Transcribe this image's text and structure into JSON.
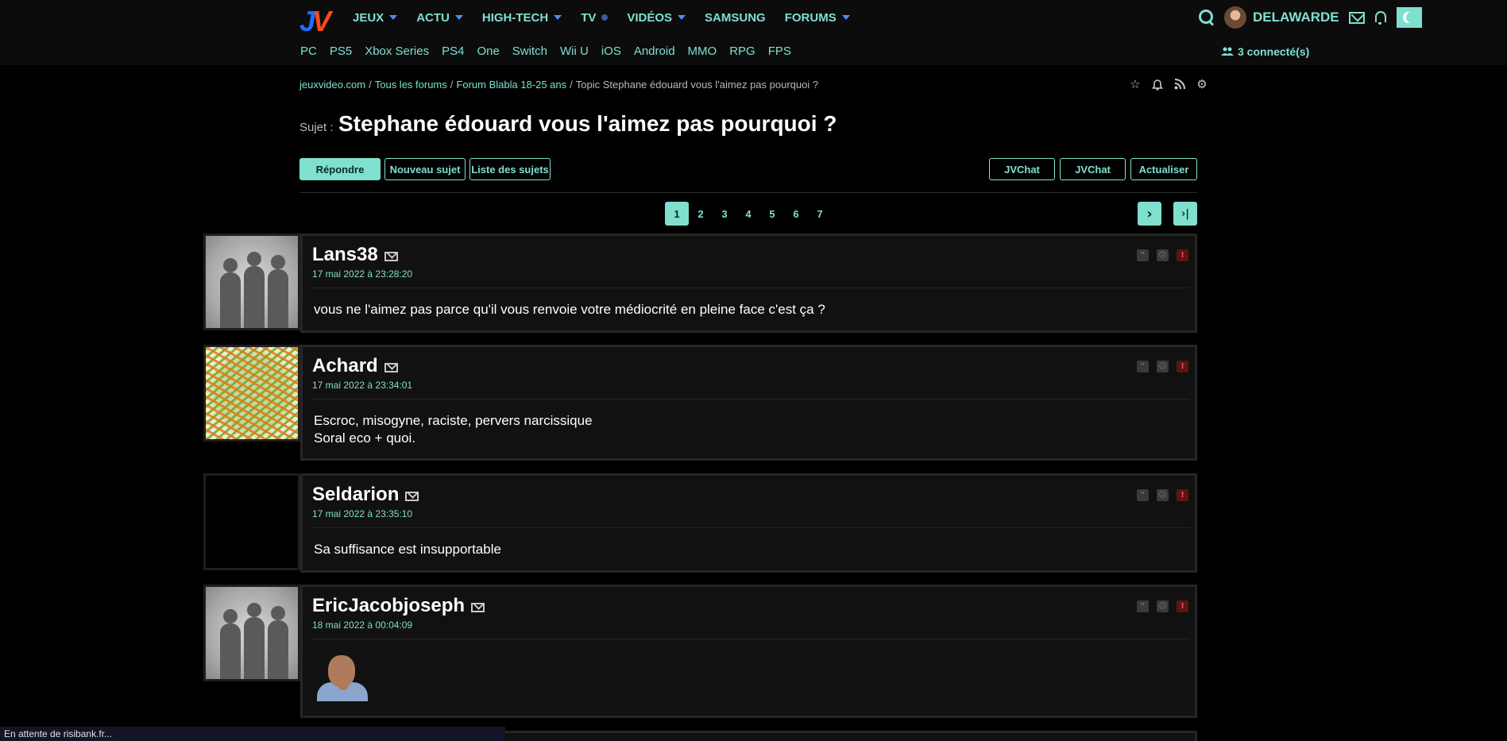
{
  "header": {
    "logo": "JV",
    "nav": [
      {
        "label": "JEUX",
        "marker": "caret"
      },
      {
        "label": "ACTU",
        "marker": "caret"
      },
      {
        "label": "HIGH-TECH",
        "marker": "caret"
      },
      {
        "label": "TV",
        "marker": "dot"
      },
      {
        "label": "VIDÉOS",
        "marker": "caret"
      },
      {
        "label": "SAMSUNG",
        "marker": "none"
      },
      {
        "label": "FORUMS",
        "marker": "caret"
      }
    ],
    "subnav": [
      "PC",
      "PS5",
      "Xbox Series",
      "PS4",
      "One",
      "Switch",
      "Wii U",
      "iOS",
      "Android",
      "MMO",
      "RPG",
      "FPS"
    ],
    "username": "DELAWARDE",
    "connected": "3 connecté(s)",
    "accent": "#7fe0d0"
  },
  "breadcrumb": {
    "items": [
      "jeuxvideo.com",
      "Tous les forums",
      "Forum Blabla 18-25 ans"
    ],
    "current": "Topic Stephane édouard vous l'aimez pas pourquoi ?",
    "separator": "/"
  },
  "topic": {
    "subject_label": "Sujet :",
    "title": "Stephane édouard vous l'aimez pas pourquoi ?"
  },
  "buttons": {
    "reply": "Répondre",
    "new_topic": "Nouveau sujet",
    "topic_list": "Liste des sujets",
    "jvchat1": "JVChat",
    "jvchat2": "JVChat",
    "refresh": "Actualiser"
  },
  "pagination": {
    "pages": [
      "1",
      "2",
      "3",
      "4",
      "5",
      "6",
      "7"
    ],
    "current": "1",
    "next": "›",
    "last": "›|"
  },
  "posts": [
    {
      "author": "Lans38",
      "date": "17 mai 2022 à 23:28:20",
      "avatar": "silhouette",
      "lines": [
        "vous ne l'aimez pas parce qu'il vous renvoie votre médiocrité en pleine face c'est ça ?"
      ]
    },
    {
      "author": "Achard",
      "date": "17 mai 2022 à 23:34:01",
      "avatar": "salad",
      "lines": [
        "Escroc, misogyne, raciste, pervers narcissique",
        "Soral eco + quoi."
      ]
    },
    {
      "author": "Seldarion",
      "date": "17 mai 2022 à 23:35:10",
      "avatar": "black",
      "lines": [
        "Sa suffisance est insupportable"
      ]
    },
    {
      "author": "EricJacobjoseph",
      "date": "18 mai 2022 à 00:04:09",
      "avatar": "silhouette",
      "lines": [],
      "image": "man-thinking-sticker"
    }
  ],
  "post_actions": {
    "quote": "\"",
    "mp": "☹",
    "alert": "!"
  },
  "statusbar": "En attente de risibank.fr..."
}
